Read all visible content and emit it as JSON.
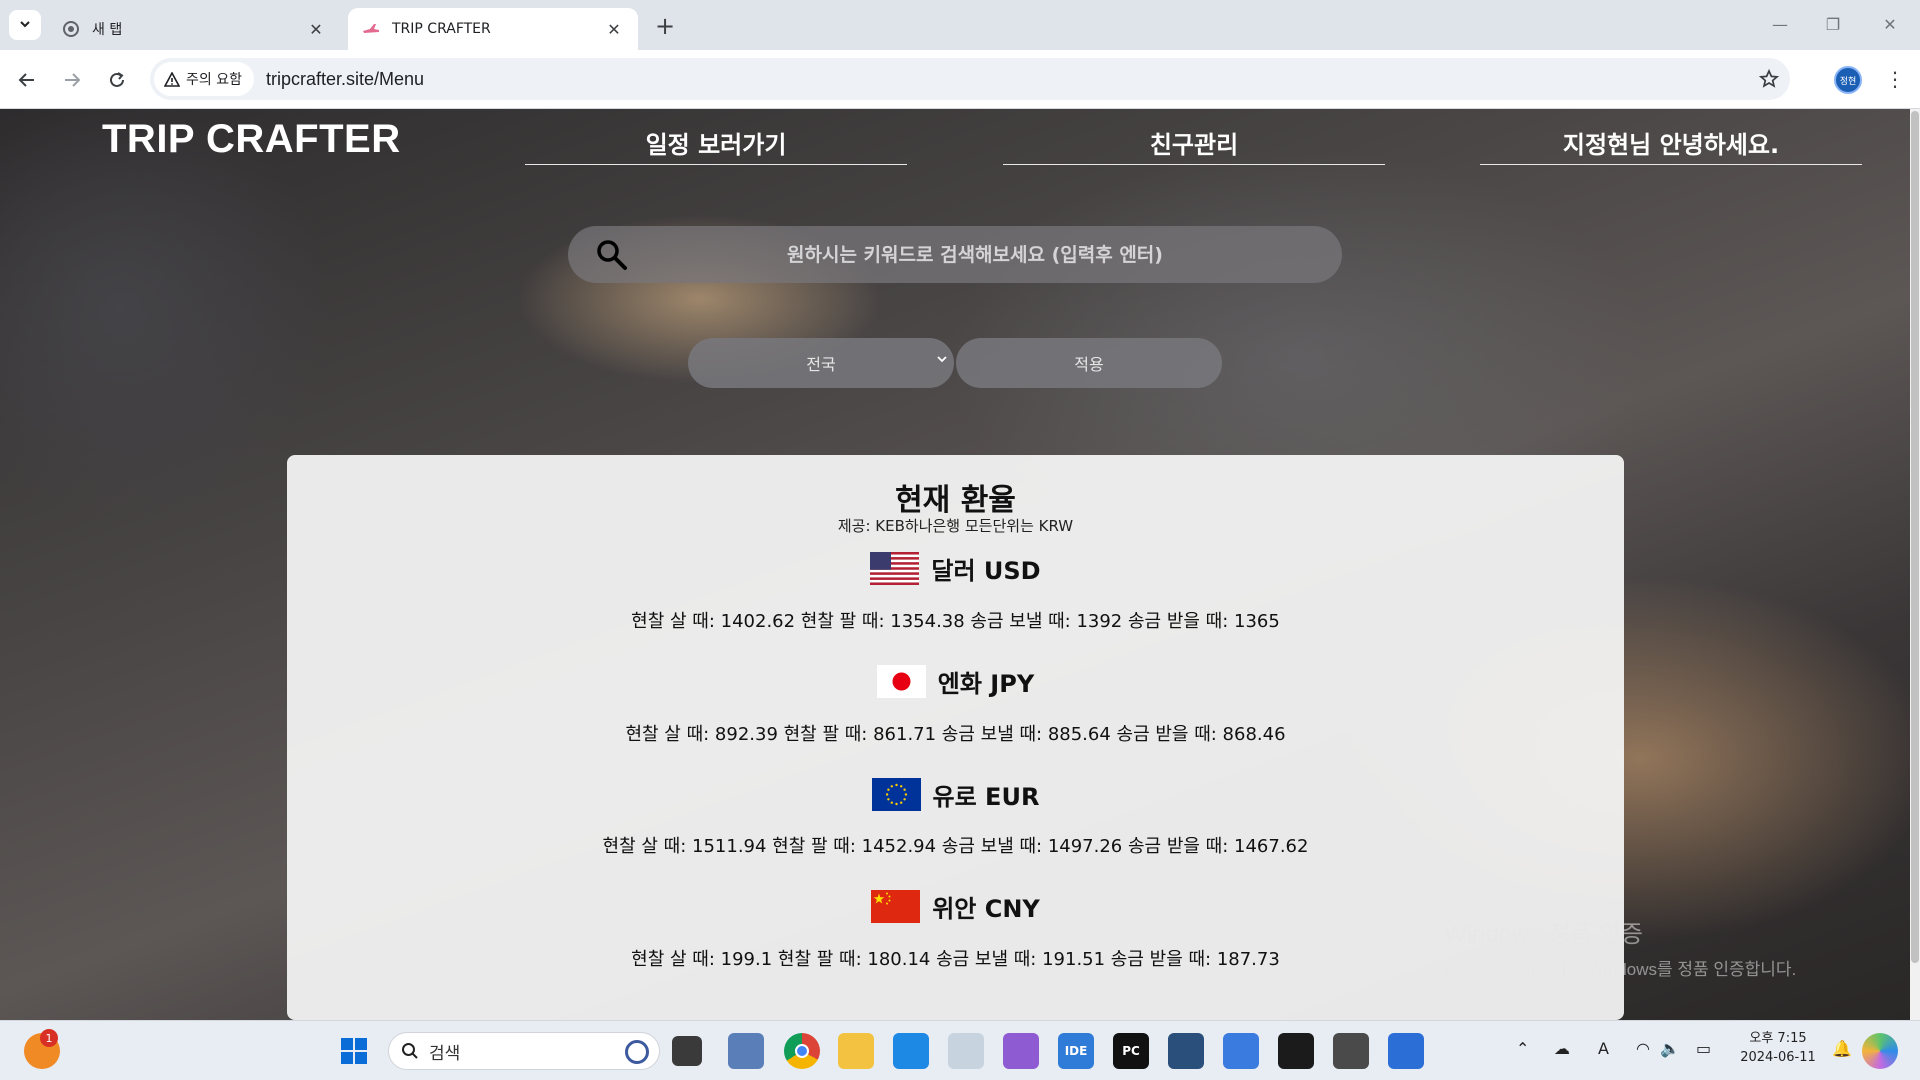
{
  "browser": {
    "tabs": [
      {
        "title": "새 탭",
        "active": false
      },
      {
        "title": "TRIP CRAFTER",
        "active": true
      }
    ],
    "security_chip": "주의 요함",
    "url": "tripcrafter.site/Menu",
    "profile_initials": "정현"
  },
  "site": {
    "brand": "TRIP CRAFTER",
    "nav": {
      "schedule": "일정 보러가기",
      "friends": "친구관리",
      "greeting": "지정현님 안녕하세요."
    },
    "search": {
      "placeholder": "원하시는 키워드로 검색해보세요 (입력후 엔터)"
    },
    "filter": {
      "region_selected": "전국",
      "apply_label": "적용"
    }
  },
  "exchange": {
    "title": "현재 환율",
    "provider": "제공: KEB하나은행 모든단위는 KRW",
    "currencies": [
      {
        "name": "달러 USD",
        "flag": "us-flag",
        "line": "현찰 살 때: 1402.62 현찰 팔 때: 1354.38 송금 보낼 때: 1392 송금 받을 때: 1365"
      },
      {
        "name": "엔화 JPY",
        "flag": "jp-flag",
        "line": "현찰 살 때: 892.39 현찰 팔 때: 861.71 송금 보낼 때: 885.64 송금 받을 때: 868.46"
      },
      {
        "name": "유로 EUR",
        "flag": "eu-flag",
        "line": "현찰 살 때: 1511.94 현찰 팔 때: 1452.94 송금 보낼 때: 1497.26 송금 받을 때: 1467.62"
      },
      {
        "name": "위안 CNY",
        "flag": "cn-flag",
        "line": "현찰 살 때: 199.1 현찰 팔 때: 180.14 송금 보낼 때: 191.51 송금 받을 때: 187.73"
      }
    ]
  },
  "watermark": {
    "line1": "Windows 정품 인증",
    "line2": "[설정]으로 이동하여 Windows를 정품 인증합니다."
  },
  "taskbar": {
    "search_label": "검색",
    "notification_badge": "1",
    "clock_time": "오후 7:15",
    "clock_date": "2024-06-11",
    "apps": [
      "start-icon",
      "task-view-icon",
      "network-app-icon",
      "chrome-icon",
      "file-explorer-icon",
      "vscode-icon",
      "snipping-icon",
      "visual-studio-icon",
      "ide-icon",
      "pycharm-icon",
      "wireshark-icon",
      "remote-icon",
      "terminal-icon",
      "console-icon",
      "document-icon"
    ]
  }
}
